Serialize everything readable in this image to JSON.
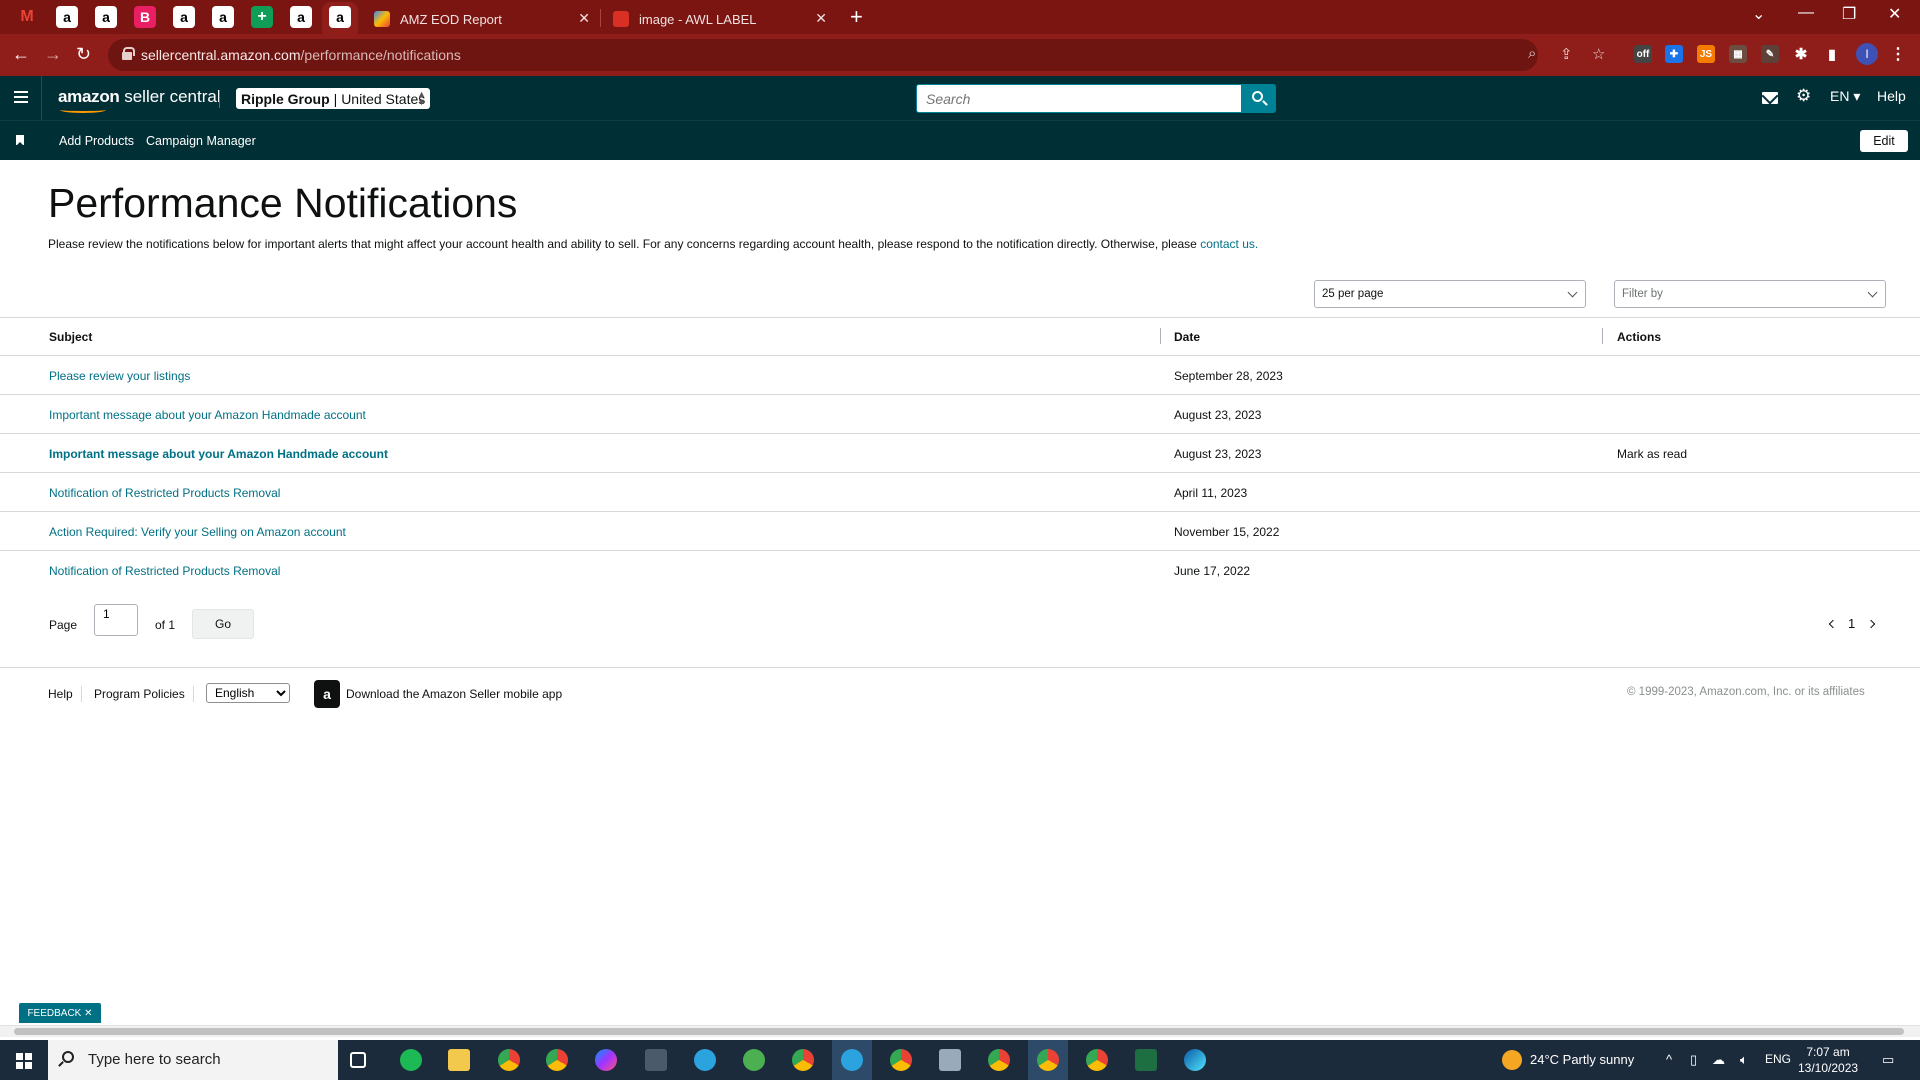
{
  "browser": {
    "tabs": [
      {
        "label": "AMZ EOD Report"
      },
      {
        "label": "image - AWL LABEL"
      }
    ],
    "url_host": "sellercentral.amazon.com",
    "url_path": "/performance/notifications",
    "profile_initial": "I"
  },
  "header": {
    "logo_amazon": "amazon",
    "logo_suffix": " seller central",
    "account_name": "Ripple Group",
    "account_market": "| United States",
    "search_placeholder": "Search",
    "language": "EN",
    "help": "Help"
  },
  "nav": {
    "links": [
      "Add Products",
      "Campaign Manager"
    ],
    "edit": "Edit"
  },
  "page": {
    "title": "Performance Notifications",
    "intro": "Please review the notifications below for important alerts that might affect your account health and ability to sell. For any concerns regarding account health, please respond to the notification directly. Otherwise, please ",
    "intro_link": "contact us.",
    "per_page": "25 per page",
    "filter_placeholder": "Filter by"
  },
  "table": {
    "headers": {
      "subject": "Subject",
      "date": "Date",
      "actions": "Actions"
    },
    "rows": [
      {
        "subject": "Please review your listings",
        "date": "September 28, 2023",
        "action": ""
      },
      {
        "subject": "Important message about your Amazon Handmade account",
        "date": "August 23, 2023",
        "action": ""
      },
      {
        "subject": "Important message about your Amazon Handmade account",
        "date": "August 23, 2023",
        "action": "Mark as read"
      },
      {
        "subject": "Notification of Restricted Products Removal",
        "date": "April 11, 2023",
        "action": ""
      },
      {
        "subject": "Action Required: Verify your Selling on Amazon account",
        "date": "November 15, 2022",
        "action": ""
      },
      {
        "subject": "Notification of Restricted Products Removal",
        "date": "June 17, 2022",
        "action": ""
      }
    ]
  },
  "pager": {
    "page_label": "Page",
    "page_value": "1",
    "of_label": "of 1",
    "go": "Go",
    "current": "1"
  },
  "footer": {
    "help": "Help",
    "policies": "Program Policies",
    "language": "English",
    "app": "Download the Amazon Seller mobile app",
    "copyright": "© 1999-2023, Amazon.com, Inc. or its affiliates",
    "feedback": "FEEDBACK"
  },
  "taskbar": {
    "search_placeholder": "Type here to search",
    "weather": "24°C  Partly sunny",
    "lang": "ENG",
    "time": "7:07 am",
    "date": "13/10/2023"
  },
  "colors": {
    "chrome_tabbar": "#7a1512",
    "chrome_toolbar": "#8f1d19",
    "sc_header": "#002f36",
    "link": "#007185",
    "search_btn": "#008296"
  }
}
